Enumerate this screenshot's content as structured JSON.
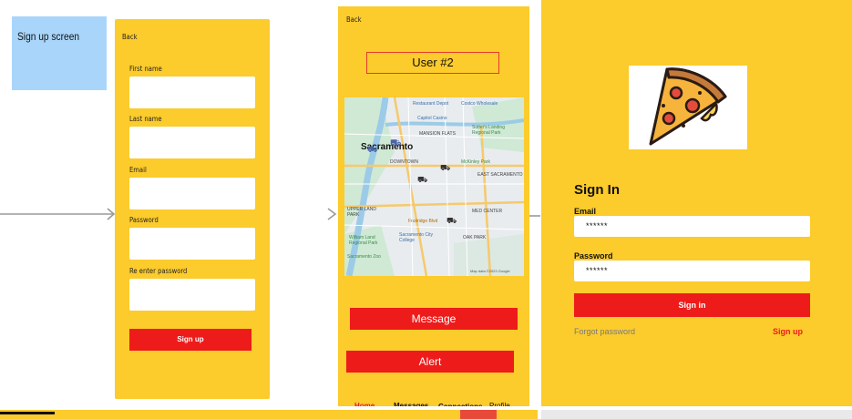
{
  "sticky": {
    "label": "Sign up screen"
  },
  "signup": {
    "back": "Back",
    "first_name": "First name",
    "last_name": "Last name",
    "email": "Email",
    "password": "Password",
    "reenter_password": "Re enter password",
    "signup_button": "Sign up"
  },
  "user_screen": {
    "back": "Back",
    "user_label": "User #2",
    "map": {
      "city": "Sacramento",
      "places": [
        "Restaurant Depot",
        "Costco Wholesale",
        "Capitol Casino",
        "MANSION FLATS",
        "Sutter's Landing Regional Park",
        "DOWNTOWN",
        "McKinley Park",
        "EAST SACRAMENTO",
        "UPPER LAND PARK",
        "MED CENTER",
        "Fruitridge Blvd",
        "OAK PARK",
        "Sacramento City College",
        "William Land Regional Park",
        "Sacramento Zoo",
        "Map data ©2023 Google"
      ]
    },
    "message_button": "Message",
    "alert_button": "Alert",
    "tabs": [
      {
        "label": "Home",
        "color": "#ee1b1b"
      },
      {
        "label": "Messages",
        "color": "#111111"
      },
      {
        "label": "Connections",
        "color": "#111111"
      },
      {
        "label": "Profile",
        "color": "#111111"
      }
    ]
  },
  "signin": {
    "title": "Sign In",
    "email_label": "Email",
    "email_value": "******",
    "password_label": "Password",
    "password_value": "******",
    "signin_button": "Sign in",
    "forgot_password": "Forgot password",
    "signup_link": "Sign up"
  },
  "colors": {
    "panel": "#fccb2c",
    "accent": "#ee1b1b",
    "sticky": "#a9d5fb"
  }
}
